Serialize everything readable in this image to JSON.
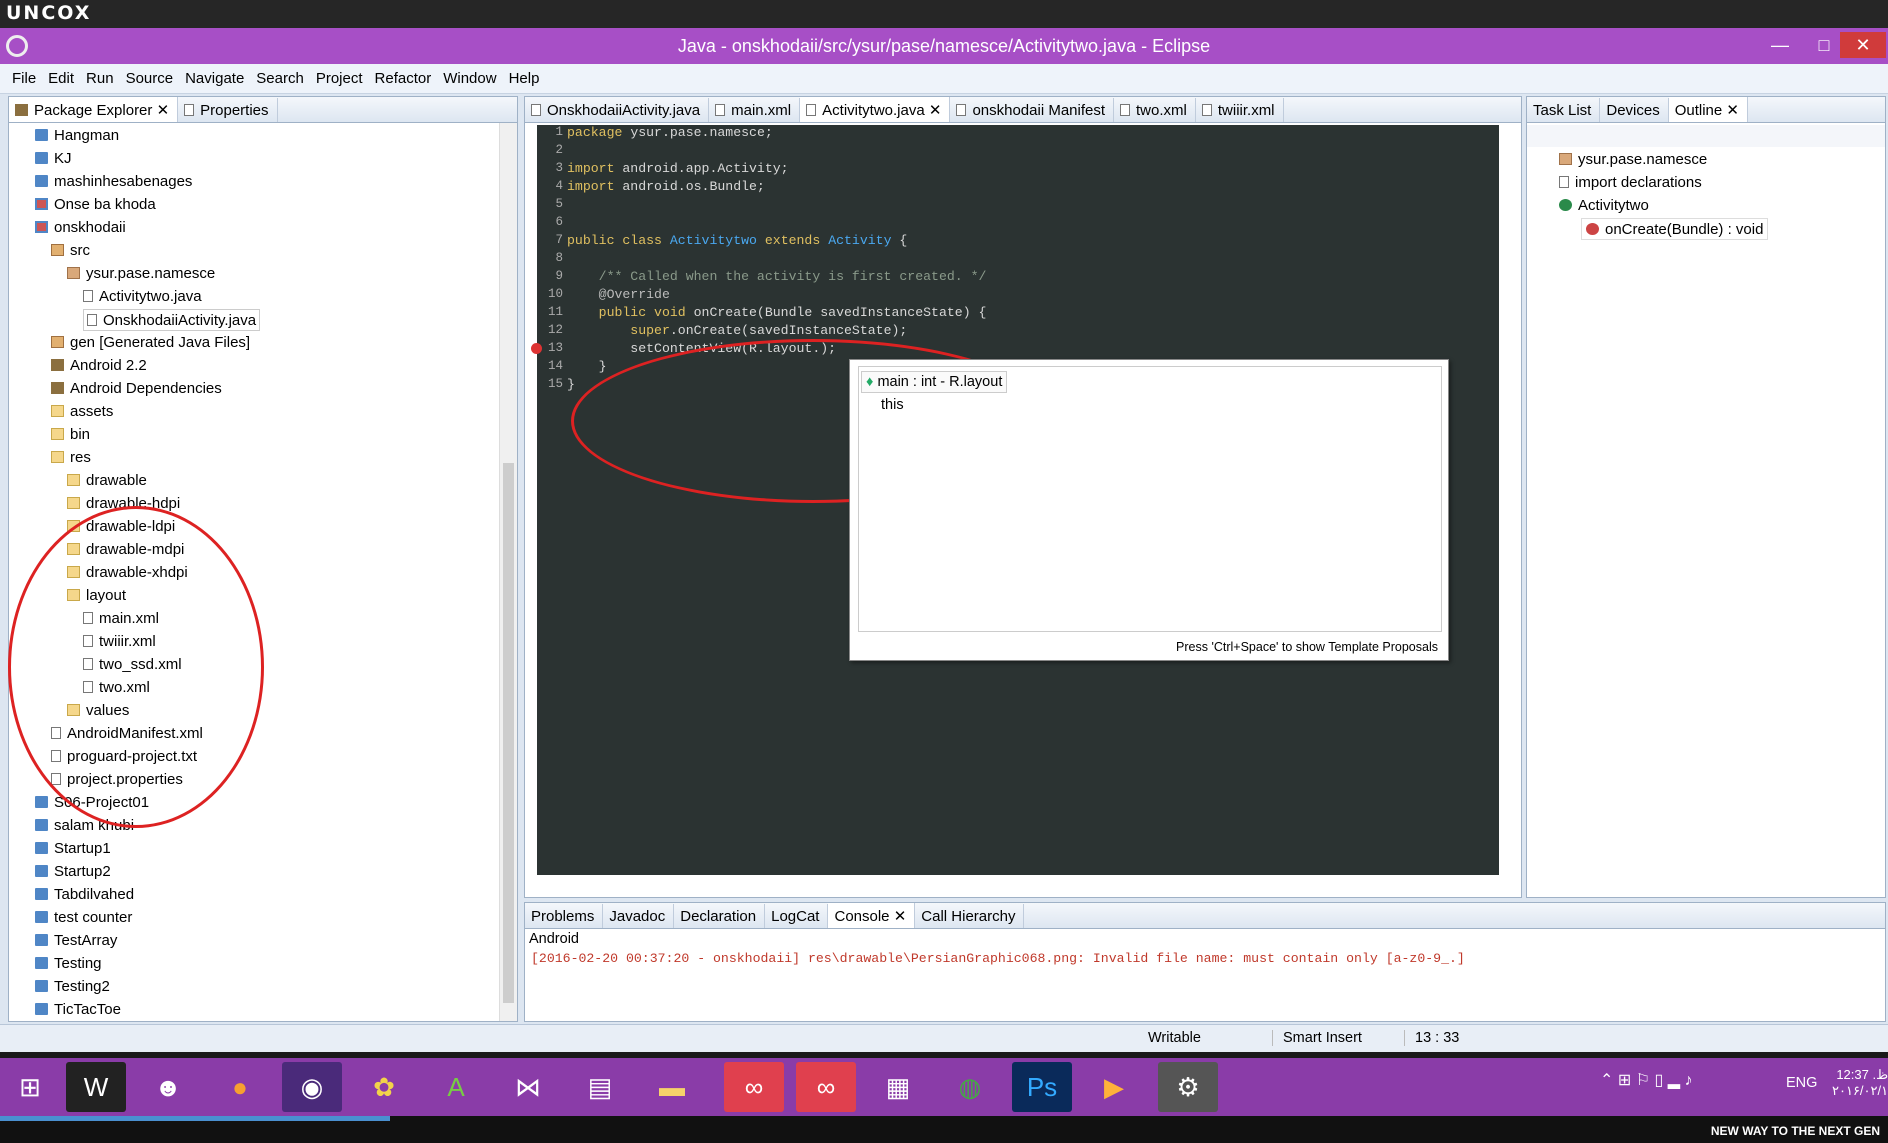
{
  "topbar": {
    "logo": "UNCOX"
  },
  "window": {
    "title": "Java - onskhodaii/src/ysur/pase/namesce/Activitytwo.java - Eclipse"
  },
  "menu": [
    "File",
    "Edit",
    "Run",
    "Source",
    "Navigate",
    "Search",
    "Project",
    "Refactor",
    "Window",
    "Help"
  ],
  "explorer": {
    "tabs": [
      "Package Explorer",
      "Properties"
    ],
    "items": [
      {
        "label": "Hangman",
        "icon": "project-icon"
      },
      {
        "label": "KJ",
        "icon": "project-icon"
      },
      {
        "label": "mashinhesabenages",
        "icon": "project-icon"
      },
      {
        "label": "Onse ba khoda",
        "icon": "project-error-icon"
      },
      {
        "label": "onskhodaii",
        "icon": "project-error-icon"
      },
      {
        "label": "src",
        "icon": "source-folder-icon"
      },
      {
        "label": "ysur.pase.namesce",
        "icon": "package-icon"
      },
      {
        "label": "Activitytwo.java",
        "icon": "java-file-icon"
      },
      {
        "label": "OnskhodaiiActivity.java",
        "icon": "java-file-icon"
      },
      {
        "label": "gen [Generated Java Files]",
        "icon": "source-folder-icon"
      },
      {
        "label": "Android 2.2",
        "icon": "library-icon"
      },
      {
        "label": "Android Dependencies",
        "icon": "library-icon"
      },
      {
        "label": "assets",
        "icon": "folder-icon"
      },
      {
        "label": "bin",
        "icon": "folder-icon"
      },
      {
        "label": "res",
        "icon": "folder-icon"
      },
      {
        "label": "drawable",
        "icon": "folder-icon"
      },
      {
        "label": "drawable-hdpi",
        "icon": "folder-icon"
      },
      {
        "label": "drawable-ldpi",
        "icon": "folder-icon"
      },
      {
        "label": "drawable-mdpi",
        "icon": "folder-icon"
      },
      {
        "label": "drawable-xhdpi",
        "icon": "folder-icon"
      },
      {
        "label": "layout",
        "icon": "folder-icon"
      },
      {
        "label": "main.xml",
        "icon": "xml-file-icon"
      },
      {
        "label": "twiiir.xml",
        "icon": "xml-file-icon"
      },
      {
        "label": "two_ssd.xml",
        "icon": "xml-file-icon"
      },
      {
        "label": "two.xml",
        "icon": "xml-file-icon"
      },
      {
        "label": "values",
        "icon": "folder-icon"
      },
      {
        "label": "AndroidManifest.xml",
        "icon": "xml-file-icon"
      },
      {
        "label": "proguard-project.txt",
        "icon": "text-file-icon"
      },
      {
        "label": "project.properties",
        "icon": "text-file-icon"
      },
      {
        "label": "S06-Project01",
        "icon": "project-icon"
      },
      {
        "label": "salam khubi",
        "icon": "project-icon"
      },
      {
        "label": "Startup1",
        "icon": "project-icon"
      },
      {
        "label": "Startup2",
        "icon": "project-icon"
      },
      {
        "label": "Tabdilvahed",
        "icon": "project-icon"
      },
      {
        "label": "test counter",
        "icon": "project-icon"
      },
      {
        "label": "TestArray",
        "icon": "project-icon"
      },
      {
        "label": "Testing",
        "icon": "project-icon"
      },
      {
        "label": "Testing2",
        "icon": "project-icon"
      },
      {
        "label": "TicTacToe",
        "icon": "project-icon"
      }
    ]
  },
  "editor": {
    "tabs": [
      "OnskhodaiiActivity.java",
      "main.xml",
      "Activitytwo.java",
      "onskhodaii Manifest",
      "two.xml",
      "twiiir.xml"
    ],
    "active_tab": "Activitytwo.java",
    "line_numbers": [
      "1",
      "2",
      "3",
      "4",
      "5",
      "6",
      "7",
      "8",
      "9",
      "10",
      "11",
      "12",
      "13",
      "14",
      "15"
    ],
    "lines": {
      "l1a": "package",
      "l1b": " ysur.pase.namesce;",
      "l3a": "import",
      "l3b": " android.app.Activity;",
      "l4a": "import",
      "l4b": " android.os.Bundle;",
      "l7a": "public class ",
      "l7b": "Activitytwo",
      "l7c": " extends ",
      "l7d": "Activity",
      "l7e": " {",
      "l9": "    /** Called when the activity is first created. */",
      "l10": "    @Override",
      "l11a": "    public void ",
      "l11b": "onCreate(Bundle savedInstanceState) {",
      "l12a": "        super",
      "l12b": ".onCreate(savedInstanceState);",
      "l13": "        setContentView(R.layout.);",
      "l14": "    }",
      "l15": "}"
    },
    "popup": {
      "items": [
        "main : int - R.layout",
        "this"
      ],
      "footer": "Press 'Ctrl+Space' to show Template Proposals"
    }
  },
  "outline": {
    "tabs": [
      "Task List",
      "Devices",
      "Outline"
    ],
    "items": [
      "ysur.pase.namesce",
      "import declarations",
      "Activitytwo",
      "onCreate(Bundle) : void"
    ]
  },
  "console": {
    "tabs": [
      "Problems",
      "Javadoc",
      "Declaration",
      "LogCat",
      "Console",
      "Call Hierarchy"
    ],
    "label": "Android",
    "message": "[2016-02-20 00:37:20 - onskhodaii] res\\drawable\\PersianGraphic068.png: Invalid file name: must contain only [a-z0-9_.]"
  },
  "status": {
    "mode": "Writable",
    "insert": "Smart Insert",
    "position": "13 : 33"
  },
  "tray": {
    "lang": "ENG",
    "time": "12:37 .ظ",
    "date": "۲۰۱۶/۰۲/۱"
  },
  "bottom_strip": "NEW WAY TO THE NEXT GEN"
}
